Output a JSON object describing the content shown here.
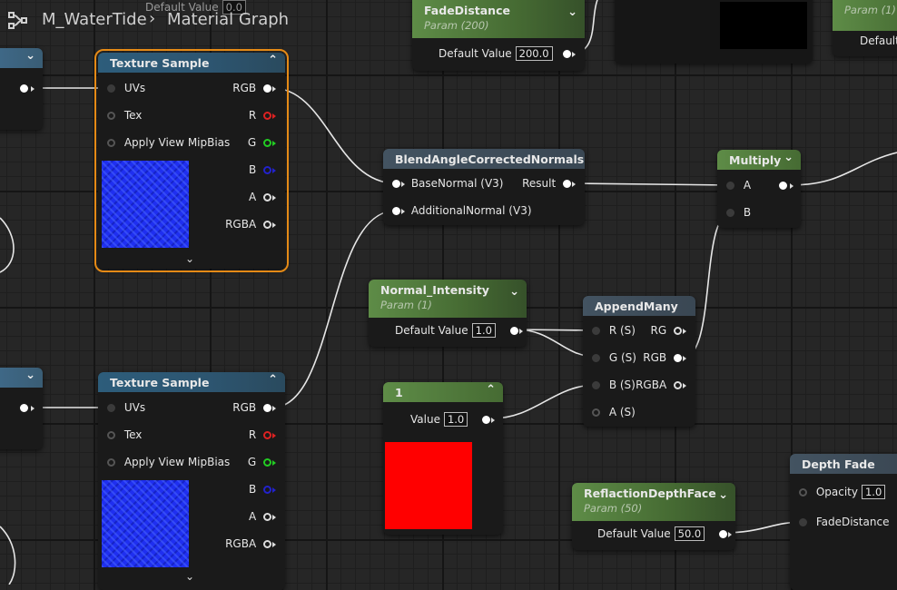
{
  "breadcrumb": {
    "material": "M_WaterTide",
    "separator": "›",
    "graph": "Material Graph"
  },
  "partial_top": {
    "default_value_label": "Default Value",
    "default_value": "0.0"
  },
  "partial_right_param": {
    "subtitle": "Param (1)",
    "default_label": "Default"
  },
  "nodes": {
    "texture_sample_1": {
      "title": "Texture Sample",
      "inputs": [
        "UVs",
        "Tex",
        "Apply View MipBias"
      ],
      "outputs": [
        "RGB",
        "R",
        "G",
        "B",
        "A",
        "RGBA"
      ]
    },
    "texture_sample_2": {
      "title": "Texture Sample",
      "inputs": [
        "UVs",
        "Tex",
        "Apply View MipBias"
      ],
      "outputs": [
        "RGB",
        "R",
        "G",
        "B",
        "A",
        "RGBA"
      ]
    },
    "fade_distance": {
      "title": "FadeDistance",
      "subtitle": "Param (200)",
      "label": "Default Value",
      "value": "200.0"
    },
    "blend_normals": {
      "title": "BlendAngleCorrectedNormals",
      "inputs": [
        "BaseNormal (V3)",
        "AdditionalNormal (V3)"
      ],
      "output": "Result"
    },
    "multiply": {
      "title": "Multiply",
      "inputs": [
        "A",
        "B"
      ]
    },
    "normal_intensity": {
      "title": "Normal_Intensity",
      "subtitle": "Param (1)",
      "label": "Default Value",
      "value": "1.0"
    },
    "append_many": {
      "title": "AppendMany",
      "inputs": [
        "R (S)",
        "G (S)",
        "B (S)",
        "A (S)"
      ],
      "outputs": [
        "RG",
        "RGB",
        "RGBA"
      ]
    },
    "constant": {
      "title": "1",
      "label": "Value",
      "value": "1.0",
      "preview_color": "#ff0000"
    },
    "refraction_depth_face": {
      "title": "ReflactionDepthFace",
      "subtitle": "Param (50)",
      "label": "Default Value",
      "value": "50.0"
    },
    "depth_fade": {
      "title": "Depth Fade",
      "inputs": [
        {
          "label": "Opacity",
          "value": "1.0"
        },
        {
          "label": "FadeDistance"
        }
      ]
    }
  },
  "colors": {
    "selection": "#e58a16",
    "wire": "#e6e6e6",
    "texture_preview": "#1f2ff0"
  }
}
